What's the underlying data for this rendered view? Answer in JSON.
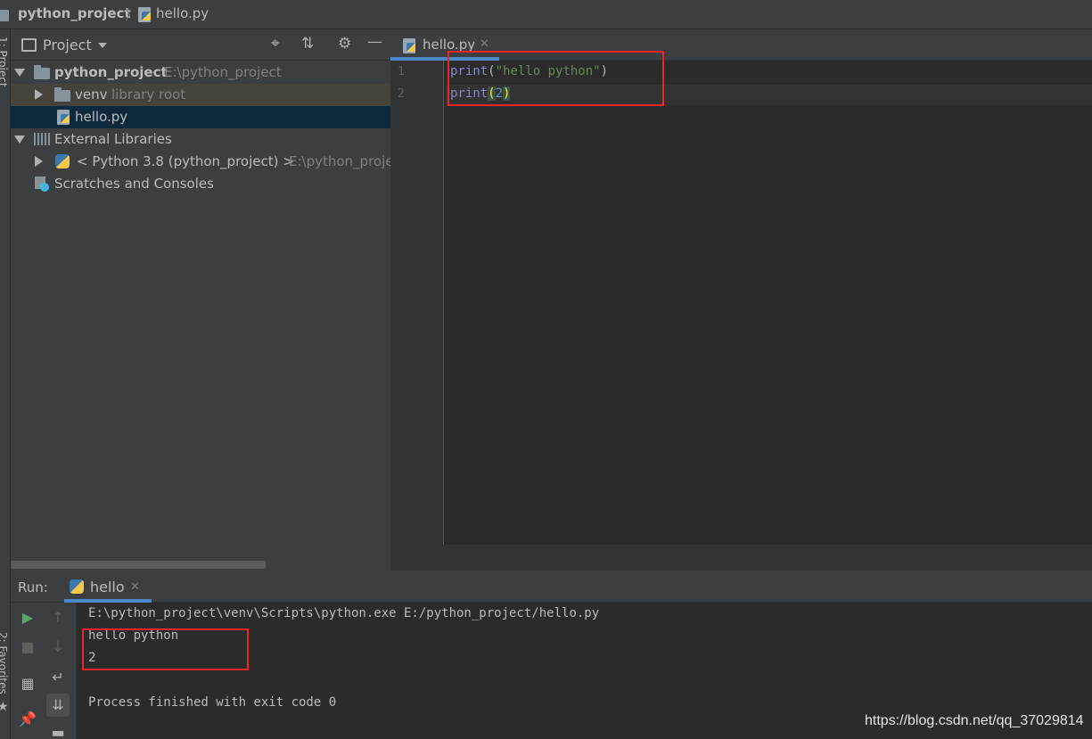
{
  "breadcrumb": {
    "project": "python_project",
    "file": "hello.py"
  },
  "left_stripe": {
    "project_label": "1: Project",
    "favorites_label": "2: Favorites"
  },
  "project_panel": {
    "title": "Project",
    "tree": {
      "root_name": "python_project",
      "root_path": "E:\\python_project",
      "venv_name": "venv",
      "venv_hint": "library root",
      "file_name": "hello.py",
      "external_libraries": "External Libraries",
      "python_sdk": "< Python 3.8 (python_project) >",
      "python_sdk_path": "E:\\python_proje",
      "scratches": "Scratches and Consoles"
    }
  },
  "editor": {
    "tab_label": "hello.py",
    "lines": [
      {
        "number": "1",
        "func": "print",
        "open": "(",
        "arg": "\"hello python\"",
        "close": ")"
      },
      {
        "number": "2",
        "func": "print",
        "open": "(",
        "arg": "2",
        "close": ")"
      }
    ]
  },
  "run_panel": {
    "label": "Run:",
    "tab_label": "hello",
    "console": {
      "command": "E:\\python_project\\venv\\Scripts\\python.exe E:/python_project/hello.py",
      "output_1": "hello python",
      "output_2": "2",
      "exit_message": "Process finished with exit code 0"
    }
  },
  "watermark": "https://blog.csdn.net/qq_37029814",
  "colors": {
    "highlight_box": "#e8262a",
    "run_green": "#59a869",
    "keyword": "#8888c6",
    "string": "#6a8759",
    "number": "#6897bb"
  }
}
